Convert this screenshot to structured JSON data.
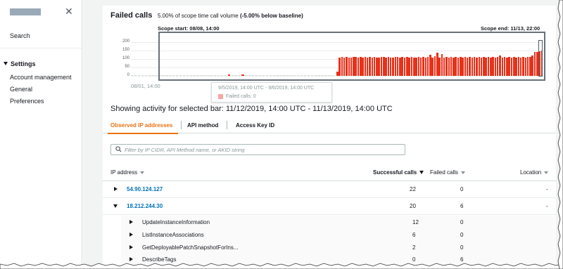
{
  "sidebar": {
    "search": "Search",
    "section": "Settings",
    "items": [
      {
        "label": "Account management"
      },
      {
        "label": "General"
      },
      {
        "label": "Preferences"
      }
    ]
  },
  "panel": {
    "title": "Failed calls",
    "subtitle_pre": "5.00% of scope time call volume ",
    "subtitle_bold": "(-5.00% below baseline)"
  },
  "chart_data": {
    "type": "bar",
    "series": [
      {
        "name": "Failed calls",
        "color": "#e8311a"
      }
    ],
    "y_ticks": [
      "200",
      "150",
      "100",
      "50",
      "0"
    ],
    "ylim": [
      0,
      200
    ],
    "x_start_label": "08/01, 14:00",
    "scope_start": "Scope start: 08/08, 14:00",
    "scope_end": "Scope end: 11/13, 22:00",
    "early_values": [
      0,
      0,
      0,
      0,
      0,
      0,
      0,
      0,
      0,
      0,
      0,
      0,
      0,
      0,
      0,
      0,
      0,
      0,
      0,
      0,
      0,
      0,
      0,
      0,
      0,
      0,
      0,
      0,
      3,
      0,
      0,
      0,
      4,
      0,
      0,
      0,
      0,
      0,
      0,
      0,
      0,
      0,
      0,
      0,
      0,
      0,
      0,
      0,
      0,
      0,
      0,
      0,
      0,
      0,
      0,
      0,
      0,
      0,
      0
    ],
    "late_values": [
      48,
      140,
      142,
      140,
      141,
      140,
      140,
      142,
      141,
      140,
      141,
      140,
      142,
      140,
      141,
      140,
      142,
      140,
      140,
      141,
      142,
      140,
      141,
      140,
      140,
      142,
      141,
      140,
      142,
      140,
      141,
      140,
      142,
      140,
      140,
      141,
      140,
      142,
      140,
      141,
      165,
      140,
      150,
      190,
      140,
      172,
      140,
      141,
      140,
      142,
      140,
      141,
      140,
      142,
      140,
      141,
      140,
      142,
      140,
      141,
      140,
      142,
      140,
      141,
      140,
      142,
      140,
      141,
      140,
      142,
      158,
      140,
      141,
      140,
      142,
      140,
      141,
      140,
      142,
      140,
      141,
      140,
      142,
      145,
      160,
      200,
      195,
      205,
      210
    ],
    "tooltip": {
      "range": "9/5/2019, 14:00 UTC - 9/6/2019, 14:00 UTC",
      "label": "Failed calls: 0"
    }
  },
  "activity": "Showing activity for selected bar: 11/12/2019, 14:00 UTC - 11/13/2019, 14:00 UTC",
  "tabs": [
    {
      "label": "Observed IP addresses",
      "active": true
    },
    {
      "label": "API method",
      "active": false
    },
    {
      "label": "Access Key ID",
      "active": false
    }
  ],
  "filter": {
    "placeholder": "Filter by IP CIDR, API Method name, or AKID string"
  },
  "table": {
    "headers": {
      "ip": "IP address",
      "success": "Successful calls",
      "failed": "Failed calls",
      "location": "Location"
    },
    "rows": [
      {
        "ip": "54.90.124.127",
        "success": "22",
        "failed": "0",
        "location": "-",
        "expanded": false
      },
      {
        "ip": "18.212.244.30",
        "success": "20",
        "failed": "6",
        "location": "-",
        "expanded": true
      }
    ],
    "sub_rows": [
      {
        "name": "UpdateInstanceInformation",
        "success": "12",
        "failed": "0"
      },
      {
        "name": "ListInstanceAssociations",
        "success": "6",
        "failed": "0"
      },
      {
        "name": "GetDeployablePatchSnapshotForIns...",
        "success": "2",
        "failed": "0"
      },
      {
        "name": "DescribeTags",
        "success": "0",
        "failed": "6"
      }
    ]
  }
}
